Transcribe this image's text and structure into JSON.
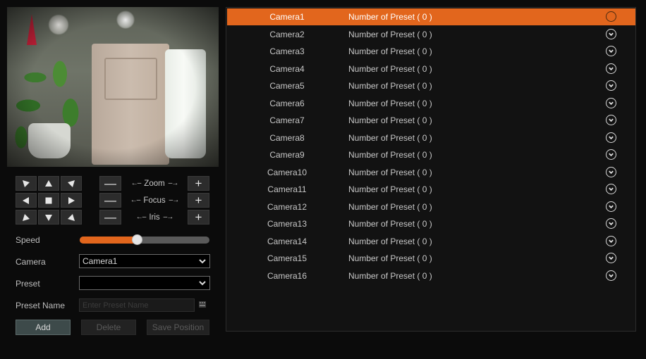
{
  "ptz": {
    "zoom_label": "Zoom",
    "focus_label": "Focus",
    "iris_label": "Iris",
    "left_arrow": "←–",
    "right_arrow": "–→",
    "minus": "—",
    "plus": "+"
  },
  "form": {
    "speed_label": "Speed",
    "speed_level": 0.44,
    "camera_label": "Camera",
    "camera_value": "Camera1",
    "preset_label": "Preset",
    "preset_value": "",
    "preset_name_label": "Preset Name",
    "preset_name_placeholder": "Enter Preset Name"
  },
  "buttons": {
    "add": "Add",
    "delete": "Delete",
    "save_position": "Save Position"
  },
  "colors": {
    "accent": "#e2661d"
  },
  "cameras": [
    {
      "name": "Camera1",
      "presets": "Number of Preset ( 0 )",
      "selected": true
    },
    {
      "name": "Camera2",
      "presets": "Number of Preset ( 0 )"
    },
    {
      "name": "Camera3",
      "presets": "Number of Preset ( 0 )"
    },
    {
      "name": "Camera4",
      "presets": "Number of Preset ( 0 )"
    },
    {
      "name": "Camera5",
      "presets": "Number of Preset ( 0 )"
    },
    {
      "name": "Camera6",
      "presets": "Number of Preset ( 0 )"
    },
    {
      "name": "Camera7",
      "presets": "Number of Preset ( 0 )"
    },
    {
      "name": "Camera8",
      "presets": "Number of Preset ( 0 )"
    },
    {
      "name": "Camera9",
      "presets": "Number of Preset ( 0 )"
    },
    {
      "name": "Camera10",
      "presets": "Number of Preset ( 0 )"
    },
    {
      "name": "Camera11",
      "presets": "Number of Preset ( 0 )"
    },
    {
      "name": "Camera12",
      "presets": "Number of Preset ( 0 )"
    },
    {
      "name": "Camera13",
      "presets": "Number of Preset ( 0 )"
    },
    {
      "name": "Camera14",
      "presets": "Number of Preset ( 0 )"
    },
    {
      "name": "Camera15",
      "presets": "Number of Preset ( 0 )"
    },
    {
      "name": "Camera16",
      "presets": "Number of Preset ( 0 )"
    }
  ]
}
